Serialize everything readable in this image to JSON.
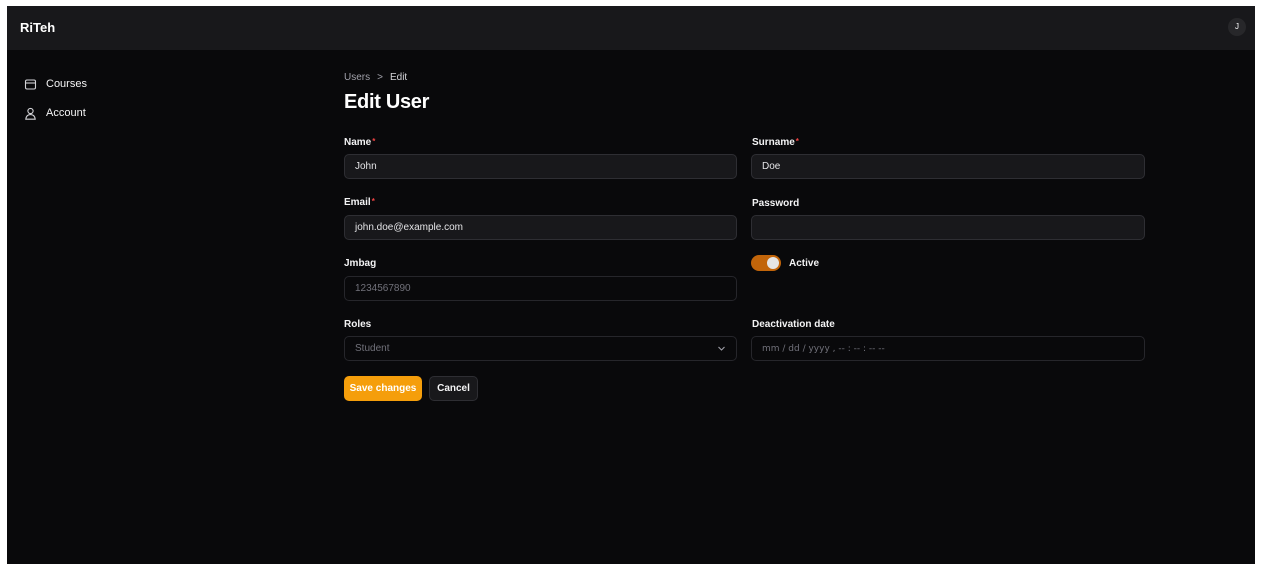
{
  "app": {
    "title": "RiTeh",
    "user_initial": "J"
  },
  "sidebar": {
    "items": [
      {
        "label": "Courses",
        "icon": "box-icon"
      },
      {
        "label": "Account",
        "icon": "user-icon"
      }
    ]
  },
  "breadcrumb": {
    "parent": "Users",
    "separator": ">",
    "current": "Edit"
  },
  "page": {
    "title": "Edit User"
  },
  "form": {
    "name": {
      "label": "Name",
      "value": "John"
    },
    "surname": {
      "label": "Surname",
      "value": "Doe"
    },
    "email": {
      "label": "Email",
      "value": "john.doe@example.com"
    },
    "password": {
      "label": "Password",
      "value": ""
    },
    "jmbag": {
      "label": "Jmbag",
      "placeholder": "1234567890"
    },
    "active": {
      "label": "Active",
      "checked": true
    },
    "roles": {
      "label": "Roles",
      "selected": "Student"
    },
    "deactivation_date": {
      "label": "Deactivation date",
      "placeholder": "mm / dd / yyyy ,  -- : -- : --  --"
    },
    "required_marker": "*"
  },
  "actions": {
    "save_label": "Save changes",
    "cancel_label": "Cancel"
  },
  "colors": {
    "accent": "#f59e0b",
    "toggle_on": "#c2650a",
    "background": "#09090b",
    "required": "#ef4444"
  }
}
